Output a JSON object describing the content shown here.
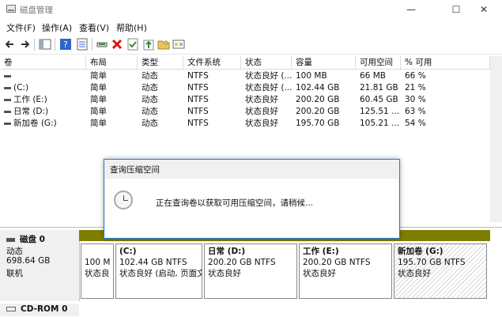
{
  "window": {
    "title": "磁盘管理",
    "minimize": "—",
    "maximize": "☐",
    "close": "✕"
  },
  "menu": [
    "文件(F)",
    "操作(A)",
    "查看(V)",
    "帮助(H)"
  ],
  "toolbar_icons": [
    "back-arrow-icon",
    "forward-arrow-icon",
    "console-tree-icon",
    "help-icon",
    "properties-icon",
    "connect-icon",
    "delete-icon",
    "check-icon",
    "export-icon",
    "open-folder-icon",
    "disk-view-icon"
  ],
  "columns": [
    "卷",
    "布局",
    "类型",
    "文件系统",
    "状态",
    "容量",
    "可用空间",
    "% 可用"
  ],
  "volumes": [
    {
      "name": "",
      "layout": "简单",
      "type": "动态",
      "fs": "NTFS",
      "status": "状态良好 (...",
      "capacity": "100 MB",
      "free": "66 MB",
      "pct": "66 %"
    },
    {
      "name": "(C:)",
      "layout": "简单",
      "type": "动态",
      "fs": "NTFS",
      "status": "状态良好 (...",
      "capacity": "102.44 GB",
      "free": "21.81 GB",
      "pct": "21 %"
    },
    {
      "name": "工作 (E:)",
      "layout": "简单",
      "type": "动态",
      "fs": "NTFS",
      "status": "状态良好",
      "capacity": "200.20 GB",
      "free": "60.45 GB",
      "pct": "30 %"
    },
    {
      "name": "日常 (D:)",
      "layout": "简单",
      "type": "动态",
      "fs": "NTFS",
      "status": "状态良好",
      "capacity": "200.20 GB",
      "free": "125.51 ...",
      "pct": "63 %"
    },
    {
      "name": "新加卷 (G:)",
      "layout": "简单",
      "type": "动态",
      "fs": "NTFS",
      "status": "状态良好",
      "capacity": "195.70 GB",
      "free": "105.21 ...",
      "pct": "54 %"
    }
  ],
  "disk0": {
    "name": "磁盘 0",
    "type": "动态",
    "size": "698.64 GB",
    "state": "联机"
  },
  "partitions": [
    {
      "title": "",
      "line1": "100 M",
      "line2": "状态良"
    },
    {
      "title": "(C:)",
      "line1": "102.44 GB NTFS",
      "line2": "状态良好 (启动, 页面文"
    },
    {
      "title": "日常 (D:)",
      "line1": "200.20 GB NTFS",
      "line2": "状态良好"
    },
    {
      "title": "工作 (E:)",
      "line1": "200.20 GB NTFS",
      "line2": "状态良好"
    },
    {
      "title": "新加卷 (G:)",
      "line1": "195.70 GB NTFS",
      "line2": "状态良好"
    }
  ],
  "cdrom": {
    "name": "CD-ROM 0"
  },
  "dialog": {
    "title": "查询压缩空间",
    "message": "正在查询卷以获取可用压缩空间，请稍候..."
  },
  "colors": {
    "dynamic_volume": "#7e7e00",
    "dialog_border": "#1f7ee0"
  }
}
